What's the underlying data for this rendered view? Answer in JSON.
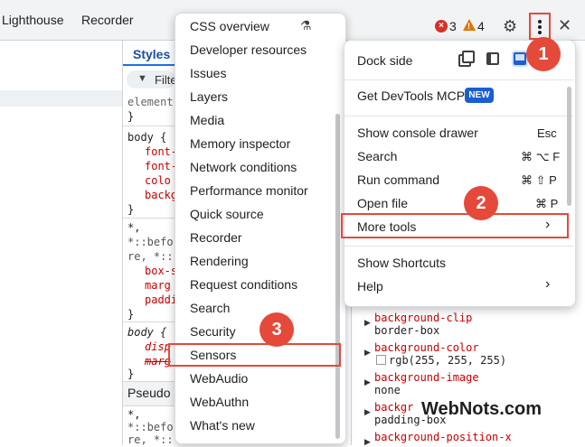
{
  "tabs": {
    "lighthouse": "Lighthouse",
    "recorder": "Recorder"
  },
  "status": {
    "errors": "3",
    "warnings": "4"
  },
  "icons": {
    "error": "error-circle-icon",
    "warning": "warning-triangle-icon",
    "settings": "gear-icon",
    "more": "kebab-menu-icon",
    "close": "close-icon",
    "filter": "filter-icon",
    "flask": "flask-icon",
    "dock": "dock-icons",
    "submenu": "chevron-right-icon"
  },
  "styles": {
    "tab_label": "Styles",
    "filter_label": "Filte",
    "pseudo_label": "Pseudo",
    "lines": [
      "element",
      "}",
      "body {",
      "font-",
      "font-",
      "colo",
      "backg",
      "}",
      "*,",
      "*::befo",
      "re, *::",
      "box-s",
      "marg",
      "paddi",
      "}",
      "body {",
      "disp",
      "marg",
      "}",
      "*,",
      "*::befo",
      "re, *::"
    ]
  },
  "submenu": {
    "items": [
      "CSS overview",
      "Developer resources",
      "Issues",
      "Layers",
      "Media",
      "Memory inspector",
      "Network conditions",
      "Performance monitor",
      "Quick source",
      "Recorder",
      "Rendering",
      "Request conditions",
      "Search",
      "Security",
      "Sensors",
      "WebAudio",
      "WebAuthn",
      "What's new"
    ],
    "highlighted": "Sensors"
  },
  "menu": {
    "dock_side": "Dock side",
    "get_mcp": "Get DevTools MCP",
    "new_badge": "NEW",
    "items": [
      {
        "label": "Show console drawer",
        "shortcut": "Esc"
      },
      {
        "label": "Search",
        "shortcut": "⌘ ⌥ F"
      },
      {
        "label": "Run command",
        "shortcut": "⌘ ⇧ P"
      },
      {
        "label": "Open file",
        "shortcut": "⌘ P"
      },
      {
        "label": "More tools",
        "shortcut": "›"
      },
      {
        "label": "Show Shortcuts",
        "shortcut": ""
      },
      {
        "label": "Help",
        "shortcut": "›"
      }
    ]
  },
  "computed": {
    "props": [
      {
        "name": "background-clip",
        "value": "border-box"
      },
      {
        "name": "background-color",
        "value": "rgb(255, 255, 255)"
      },
      {
        "name": "background-image",
        "value": "none"
      },
      {
        "name": "backgr",
        "value": "padding-box"
      },
      {
        "name": "background-position-x",
        "value": ""
      }
    ]
  },
  "callouts": [
    "1",
    "2",
    "3"
  ],
  "watermark": "WebNots.com",
  "colors": {
    "accent_red": "#e5493a",
    "link_blue": "#1a73e8",
    "badge_blue": "#1a5fd0"
  }
}
